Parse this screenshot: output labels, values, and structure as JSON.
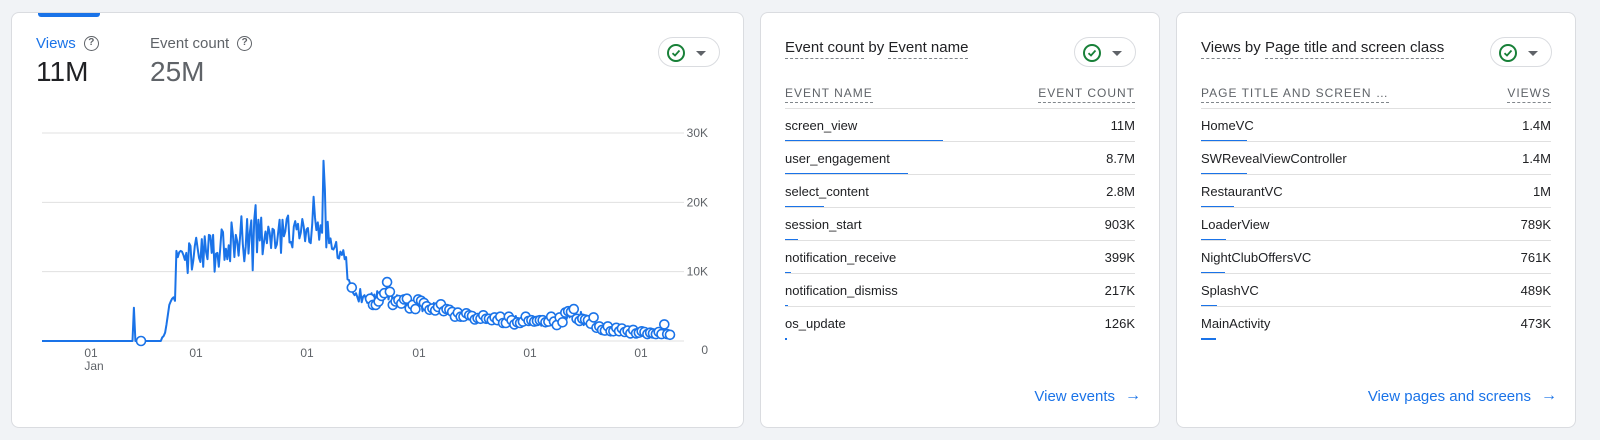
{
  "overview": {
    "metrics": [
      {
        "label": "Views",
        "value": "11M"
      },
      {
        "label": "Event count",
        "value": "25M"
      }
    ],
    "help_glyph": "?"
  },
  "chart_data": {
    "type": "line",
    "x_tick_labels": [
      "01",
      "01",
      "01",
      "01",
      "01",
      "01"
    ],
    "x_sub_label": "Jan",
    "y_ticks": [
      "0",
      "10K",
      "20K",
      "30K"
    ],
    "ylim": [
      0,
      30000
    ],
    "grid": true,
    "series": [
      {
        "values": [
          0,
          0,
          0,
          0,
          0,
          0,
          0,
          0,
          0,
          0,
          0,
          0,
          0,
          0,
          0,
          0,
          0,
          0,
          0,
          0,
          0,
          0,
          0,
          0,
          0,
          0,
          0,
          0,
          0,
          0,
          0,
          0,
          0,
          0,
          0,
          0,
          0,
          0,
          0,
          0,
          0,
          0,
          0,
          0,
          0,
          0,
          0,
          0,
          0,
          0,
          0,
          0,
          0,
          0,
          0,
          0,
          0,
          0,
          0,
          0,
          0,
          0,
          0,
          0,
          0,
          4800,
          0,
          0,
          0,
          0,
          0,
          0,
          0,
          0,
          0,
          0,
          0,
          0,
          0,
          0,
          0,
          0,
          0,
          0,
          0,
          500,
          700,
          1200,
          2400,
          3800,
          5200,
          5700,
          6100,
          6300,
          5800,
          13000,
          12100,
          12800,
          13000,
          12900,
          12400,
          11700,
          12700,
          9800,
          14100,
          13700,
          10300,
          11600,
          13700,
          14900,
          13400,
          12000,
          11400,
          14700,
          10700,
          15100,
          12800,
          11800,
          15300,
          15200,
          12700,
          15300,
          10000,
          12600,
          12700,
          10700,
          13300,
          16100,
          15700,
          11700,
          13300,
          11800,
          13800,
          11500,
          17100,
          15300,
          12100,
          15300,
          14400,
          12300,
          14900,
          18000,
          14000,
          11500,
          13600,
          17600,
          12600,
          15700,
          17400,
          10200,
          17400,
          19600,
          12800,
          17500,
          14500,
          17800,
          12500,
          14400,
          15800,
          14100,
          16500,
          15600,
          13400,
          16200,
          16000,
          13400,
          13900,
          15700,
          17500,
          12700,
          17500,
          15100,
          15800,
          17600,
          18100,
          14200,
          14300,
          13500,
          16500,
          17300,
          16100,
          16900,
          14800,
          15600,
          17600,
          16500,
          14400,
          16100,
          16300,
          14300,
          14100,
          16800,
          20800,
          17800,
          16000,
          17100,
          14600,
          16700,
          15600,
          26000,
          21800,
          13500,
          17200,
          14100,
          14800,
          13300,
          13200,
          13600,
          14300,
          12000,
          11900,
          12900,
          12400,
          13100,
          11800,
          12100,
          8900,
          8800,
          8200,
          7700,
          6900,
          6600,
          6900,
          6300,
          5700,
          7500,
          5600,
          6400,
          6600,
          6100,
          5500,
          6500,
          6100,
          6900,
          5200,
          6700,
          5200,
          7200,
          5700,
          6300,
          6500,
          5800,
          6900,
          6600,
          8500,
          6000,
          7100,
          7400,
          5200,
          6300,
          5700,
          6600,
          5900,
          6200,
          5400,
          5700,
          6000,
          5700,
          6100,
          4700,
          4700,
          4200,
          5200,
          5600,
          4600,
          6100,
          6000,
          5100,
          5800,
          4300,
          5500,
          5300,
          5000,
          4400,
          4500,
          4800,
          4700,
          5500,
          4400,
          4700,
          4900,
          4200,
          5300,
          4500,
          4300,
          3900,
          4600,
          3900,
          4500,
          4000,
          4200,
          4100,
          3500,
          3800,
          4100,
          3800,
          3500,
          3900,
          3500,
          4000,
          4000,
          3200,
          3700,
          4000,
          3600,
          3100,
          3100,
          3600,
          3300,
          3000,
          3200,
          3300,
          3700,
          3000,
          3200,
          3000,
          3200,
          3600,
          3000,
          3300,
          3400,
          2900,
          3000,
          2700,
          3500,
          3000,
          2600,
          3100,
          2600,
          3000,
          3500,
          3300,
          3000,
          2900,
          2400,
          3600,
          2700,
          2800,
          2600,
          3200,
          2800,
          3000,
          3500,
          2500,
          2900,
          2400,
          3000,
          2900,
          2800,
          2400,
          2900,
          2700,
          3000,
          2200,
          3000,
          2900,
          2700,
          3100,
          2800,
          2700,
          3500,
          2600,
          2800,
          2900,
          2300,
          2500,
          3400,
          3000,
          2700,
          2800,
          4100,
          3200,
          4300,
          3400,
          4200,
          3700,
          4600,
          2800,
          3200,
          3800,
          2900,
          4200,
          3200,
          2300,
          3100,
          2500,
          3000,
          2900,
          2500,
          2800,
          3400,
          1800,
          1900,
          1700,
          2100,
          2100,
          1600,
          1600,
          1500,
          2400,
          2100,
          1500,
          1400,
          1900,
          1400,
          1800,
          1900,
          1900,
          1400,
          1300,
          1800,
          1200,
          1300,
          1100,
          1500,
          1300,
          1100,
          1400,
          1600,
          1200,
          1100,
          1500,
          1200,
          1200,
          1400,
          1400,
          1300,
          1100,
          1000,
          1300,
          1200,
          1100,
          1100,
          1500,
          1000,
          900,
          1300,
          1200,
          1000,
          1100,
          2400,
          900,
          1000,
          1300,
          900
        ]
      }
    ]
  },
  "events_card": {
    "title_metric": "Event count",
    "title_by": "by",
    "title_dim": "Event name",
    "col_left": "EVENT NAME",
    "col_right": "EVENT COUNT",
    "rows": [
      {
        "name": "screen_view",
        "value": "11M",
        "share": 0.45
      },
      {
        "name": "user_engagement",
        "value": "8.7M",
        "share": 0.35
      },
      {
        "name": "select_content",
        "value": "2.8M",
        "share": 0.11
      },
      {
        "name": "session_start",
        "value": "903K",
        "share": 0.037
      },
      {
        "name": "notification_receive",
        "value": "399K",
        "share": 0.016
      },
      {
        "name": "notification_dismiss",
        "value": "217K",
        "share": 0.009
      },
      {
        "name": "os_update",
        "value": "126K",
        "share": 0.005
      }
    ],
    "link": "View events",
    "arrow": "→"
  },
  "pages_card": {
    "title_metric": "Views",
    "title_by": "by",
    "title_dim": "Page title and screen class",
    "col_left": "PAGE TITLE AND SCREEN …",
    "col_right": "VIEWS",
    "rows": [
      {
        "name": "HomeVC",
        "value": "1.4M",
        "share": 0.13
      },
      {
        "name": "SWRevealViewController",
        "value": "1.4M",
        "share": 0.13
      },
      {
        "name": "RestaurantVC",
        "value": "1M",
        "share": 0.095
      },
      {
        "name": "LoaderView",
        "value": "789K",
        "share": 0.072
      },
      {
        "name": "NightClubOffersVC",
        "value": "761K",
        "share": 0.069
      },
      {
        "name": "SplashVC",
        "value": "489K",
        "share": 0.045
      },
      {
        "name": "MainActivity",
        "value": "473K",
        "share": 0.043
      }
    ],
    "link": "View pages and screens",
    "arrow": "→"
  },
  "colors": {
    "accent": "#1a73e8",
    "ok": "#188038",
    "muted": "#5f6368"
  }
}
